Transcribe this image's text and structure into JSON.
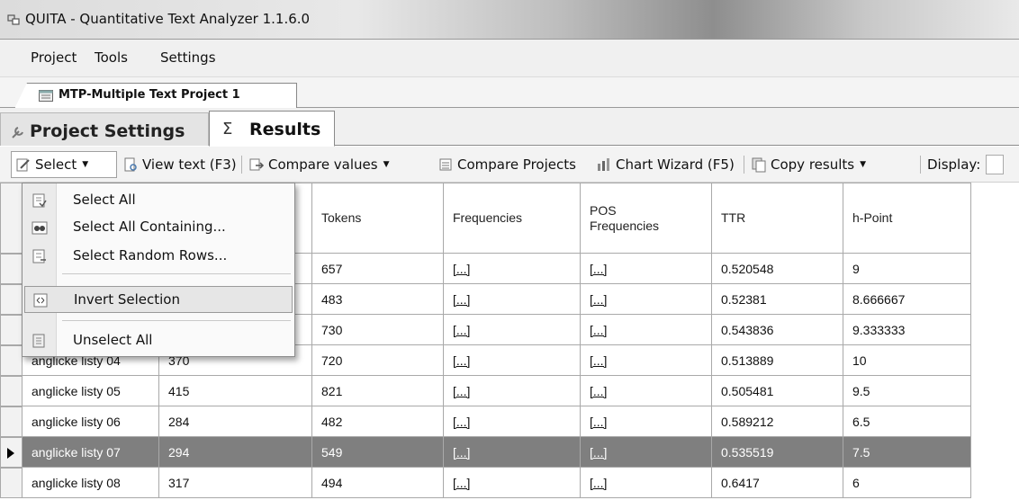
{
  "window": {
    "title": "QUITA - Quantitative Text Analyzer 1.1.6.0"
  },
  "menu": [
    "Project",
    "Tools",
    "Settings"
  ],
  "document_tab": "MTP-Multiple Text Project 1",
  "inner_tabs": {
    "settings": "Project Settings",
    "results_symbol": "Σ",
    "results": "Results"
  },
  "toolbar": {
    "select": "Select",
    "view_text": "View text (F3)",
    "compare_values": "Compare values",
    "compare_projects": "Compare Projects",
    "chart_wizard": "Chart Wizard (F5)",
    "copy_results": "Copy results",
    "display": "Display:"
  },
  "select_menu": {
    "select_all": "Select All",
    "select_all_containing": "Select All Containing...",
    "select_random_rows": "Select Random Rows...",
    "invert_selection": "Invert Selection",
    "unselect_all": "Unselect All"
  },
  "table": {
    "columns": [
      "",
      "",
      "Tokens",
      "Frequencies",
      "POS Frequencies",
      "TTR",
      "h-Point"
    ],
    "rows": [
      [
        "",
        "",
        "657",
        "[...]",
        "[...]",
        "0.520548",
        "9"
      ],
      [
        "",
        "",
        "483",
        "[...]",
        "[...]",
        "0.52381",
        "8.666667"
      ],
      [
        "",
        "",
        "730",
        "[...]",
        "[...]",
        "0.543836",
        "9.333333"
      ],
      [
        "anglicke listy 04",
        "370",
        "720",
        "[...]",
        "[...]",
        "0.513889",
        "10"
      ],
      [
        "anglicke listy 05",
        "415",
        "821",
        "[...]",
        "[...]",
        "0.505481",
        "9.5"
      ],
      [
        "anglicke listy 06",
        "284",
        "482",
        "[...]",
        "[...]",
        "0.589212",
        "6.5"
      ],
      [
        "anglicke listy 07",
        "294",
        "549",
        "[...]",
        "[...]",
        "0.535519",
        "7.5"
      ],
      [
        "anglicke listy 08",
        "317",
        "494",
        "[...]",
        "[...]",
        "0.6417",
        "6"
      ]
    ],
    "selected_row": 6
  }
}
